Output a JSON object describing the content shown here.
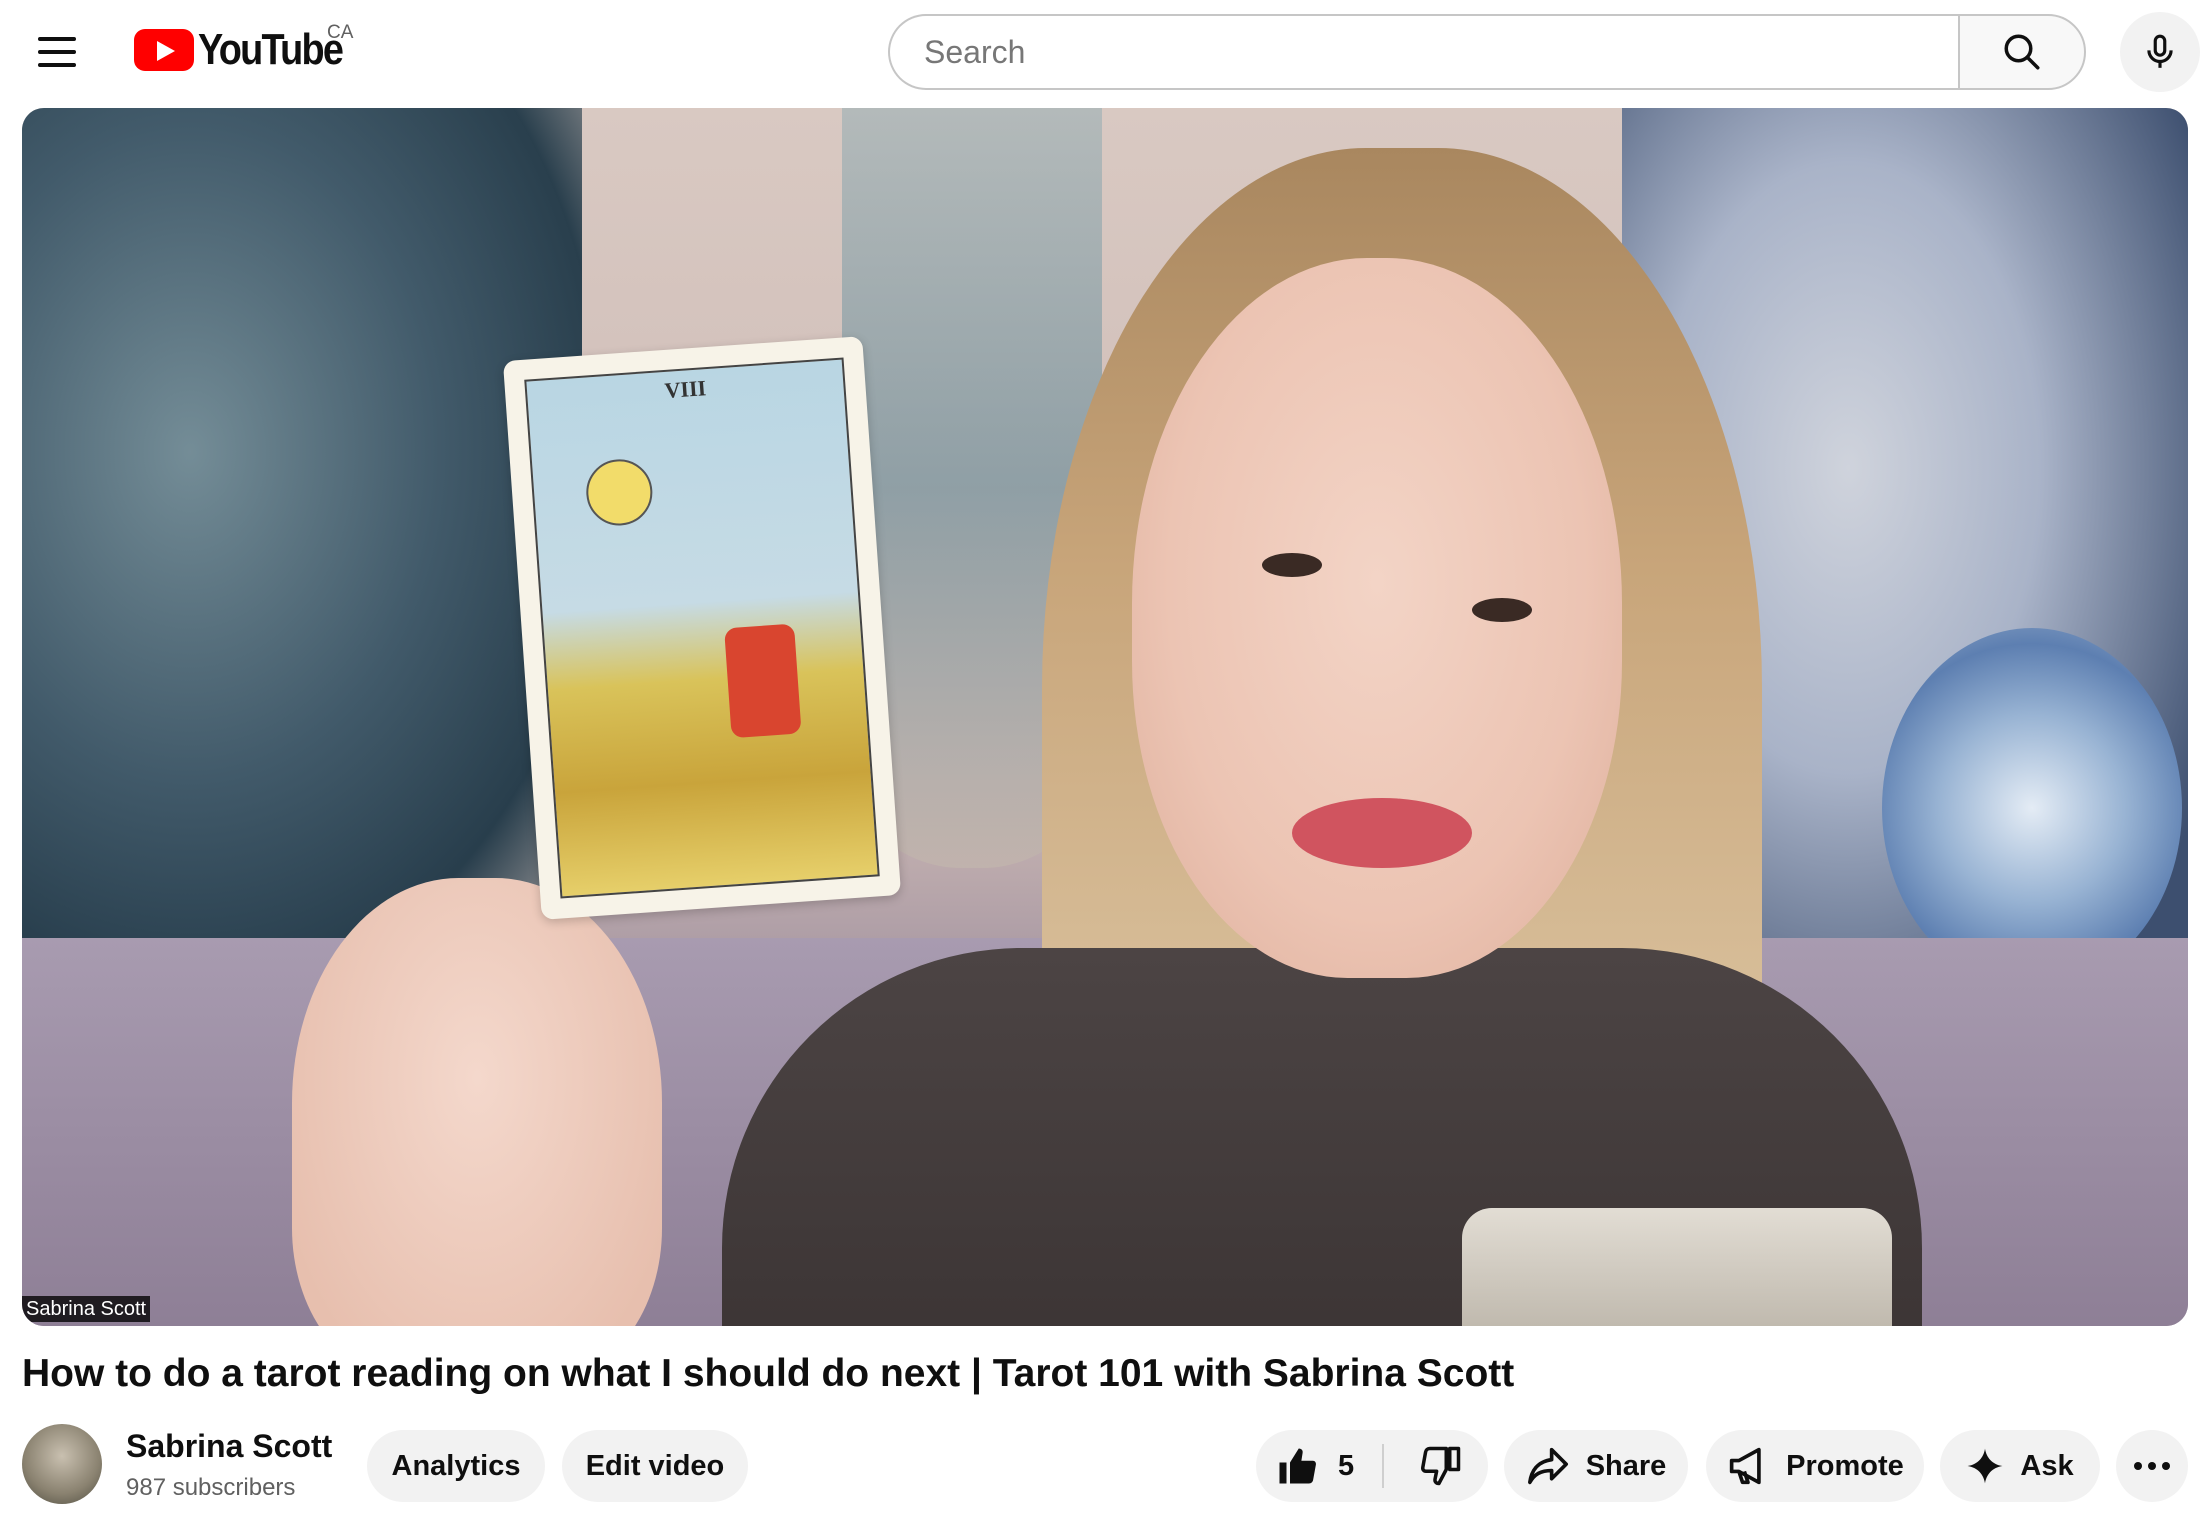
{
  "header": {
    "logo_text": "YouTube",
    "region": "CA",
    "search_placeholder": "Search",
    "icons": [
      "menu-icon",
      "youtube-logo",
      "search-icon",
      "microphone-icon"
    ]
  },
  "video": {
    "overlay_label": "Sabrina Scott",
    "card_numeral": "VIII"
  },
  "title": "How to do a tarot reading on what I should do next | Tarot 101 with Sabrina Scott",
  "channel": {
    "name": "Sabrina Scott",
    "subscribers": "987 subscribers"
  },
  "actions": {
    "analytics": "Analytics",
    "edit_video": "Edit video",
    "like_count": "5",
    "share": "Share",
    "promote": "Promote",
    "ask": "Ask"
  },
  "colors": {
    "brand_red": "#ff0000",
    "button_bg": "#f2f2f2",
    "text": "#0f0f0f",
    "secondary_text": "#606060"
  }
}
